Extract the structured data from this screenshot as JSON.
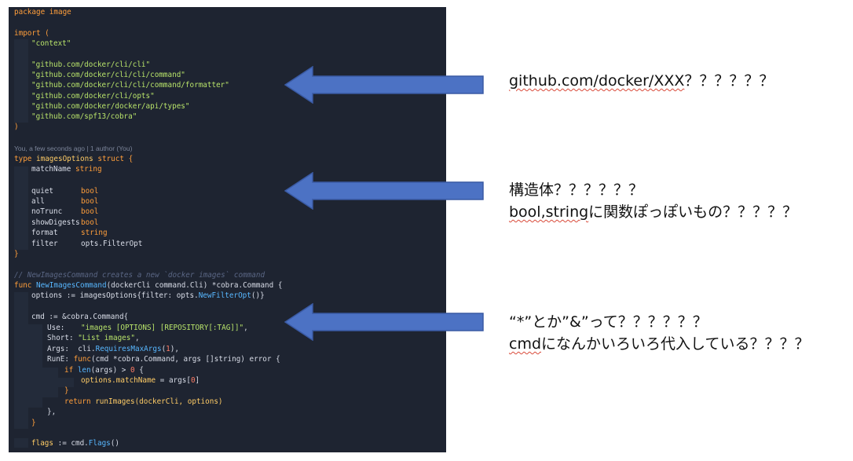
{
  "colors": {
    "editor_bg": "#1e2431",
    "keyword": "#ff9e3b",
    "string": "#b8e36a",
    "type": "#5fc5ff",
    "function": "#58b7ff",
    "comment": "#5a6684",
    "arrow_fill": "#4c72c4",
    "arrow_stroke": "#3a5aa3"
  },
  "code": {
    "package": "package image",
    "import_open": "import (",
    "imp_context": "\"context\"",
    "imp_1": "\"github.com/docker/cli/cli\"",
    "imp_2": "\"github.com/docker/cli/cli/command\"",
    "imp_3": "\"github.com/docker/cli/cli/command/formatter\"",
    "imp_4": "\"github.com/docker/cli/opts\"",
    "imp_5": "\"github.com/docker/docker/api/types\"",
    "imp_6": "\"github.com/spf13/cobra\"",
    "import_close": ")",
    "blame": "You, a few seconds ago | 1 author (You)",
    "struct_type_kw": "type",
    "struct_name": "imagesOptions",
    "struct_kw": "struct",
    "brace_open": "{",
    "brace_close": "}",
    "fields": {
      "matchName": "matchName",
      "quiet": "quiet",
      "all": "all",
      "noTrunc": "noTrunc",
      "showDigests": "showDigests",
      "format": "format",
      "filter": "filter",
      "t_string": "string",
      "t_bool": "bool",
      "t_filter": "opts.FilterOpt"
    },
    "comment": "// NewImagesCommand creates a new `docker images` command",
    "func_kw": "func",
    "func_name": "NewImagesCommand",
    "func_params": "(dockerCli command.Cli) *cobra.Command {",
    "opts_a": "options := imagesOptions{filter: opts.",
    "opts_fn": "NewFilterOpt",
    "opts_b": "()}",
    "cmd_a": "cmd := &cobra.Command{",
    "use_key": "Use:",
    "use_val": "\"images [OPTIONS] [REPOSITORY[:TAG]]\"",
    "short_key": "Short:",
    "short_val": "\"List images\"",
    "args_key": "Args:",
    "args_a": "cli.",
    "args_fn": "RequiresMaxArgs",
    "args_paren_open": "(",
    "args_num": "1",
    "args_b": "),",
    "rune_key": "RunE:",
    "rune_func": "func",
    "rune_rest": "(cmd *cobra.Command, args []string) error {",
    "if_kw": "if",
    "len_fn": "len",
    "if_rest": "(args) > ",
    "if_num": "0",
    "if_brace": " {",
    "match_a": "options.",
    "match_prop": "matchName",
    "match_b": " = args[",
    "match_num": "0",
    "match_c": "]",
    "return_kw": "return",
    "run_fn": "runImages",
    "run_rest": "(dockerCli, options)",
    "close_comma": "},",
    "close_brace": "}",
    "flags_a": "flags",
    "flags_b": " := cmd.",
    "flags_fn": "Flags",
    "flags_c": "()"
  },
  "notes": {
    "note1_link": "github.com/docker/XXX",
    "note1_q": "？？？？？？",
    "note2_line1": "構造体？？？？？？",
    "note2_line2_link": "bool,string",
    "note2_line2_rest": "に関数ぽっぽいもの？？？？？",
    "note3_line1": "“*”とか”&”って？？？？？？",
    "note3_line2_link": "cmd",
    "note3_line2_rest": "になんかいろいろ代入している？？？？"
  }
}
